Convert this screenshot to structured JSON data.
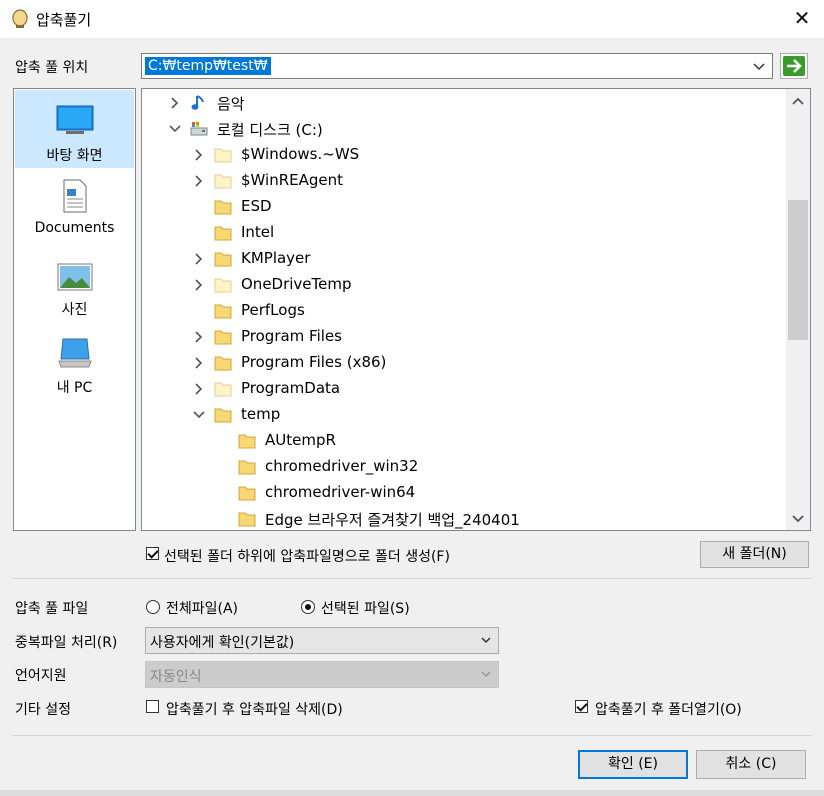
{
  "window": {
    "title": "압축풀기",
    "close_glyph": "✕"
  },
  "path": {
    "label": "압축 풀 위치",
    "value": "C:₩temp₩test₩"
  },
  "places": [
    {
      "label": "바탕 화면",
      "icon": "desktop-icon"
    },
    {
      "label": "Documents",
      "icon": "documents-icon"
    },
    {
      "label": "사진",
      "icon": "pictures-icon"
    },
    {
      "label": "내 PC",
      "icon": "computer-icon"
    }
  ],
  "tree": [
    {
      "label": "음악",
      "icon": "music-icon",
      "expander": "collapsed"
    },
    {
      "label": "로컬 디스크 (C:)",
      "icon": "drive-icon",
      "expander": "expanded"
    },
    {
      "label": "$Windows.~WS",
      "icon": "folder-pale-icon",
      "expander": "collapsed"
    },
    {
      "label": "$WinREAgent",
      "icon": "folder-pale-icon",
      "expander": "collapsed"
    },
    {
      "label": "ESD",
      "icon": "folder-icon",
      "expander": "none"
    },
    {
      "label": "Intel",
      "icon": "folder-icon",
      "expander": "none"
    },
    {
      "label": "KMPlayer",
      "icon": "folder-icon",
      "expander": "collapsed"
    },
    {
      "label": "OneDriveTemp",
      "icon": "folder-pale-icon",
      "expander": "collapsed"
    },
    {
      "label": "PerfLogs",
      "icon": "folder-icon",
      "expander": "none"
    },
    {
      "label": "Program Files",
      "icon": "folder-icon",
      "expander": "collapsed"
    },
    {
      "label": "Program Files (x86)",
      "icon": "folder-icon",
      "expander": "collapsed"
    },
    {
      "label": "ProgramData",
      "icon": "folder-pale-icon",
      "expander": "collapsed"
    },
    {
      "label": "temp",
      "icon": "folder-icon",
      "expander": "expanded"
    },
    {
      "label": "AUtempR",
      "icon": "folder-icon",
      "expander": "none"
    },
    {
      "label": "chromedriver_win32",
      "icon": "folder-icon",
      "expander": "none"
    },
    {
      "label": "chromedriver-win64",
      "icon": "folder-icon",
      "expander": "none"
    },
    {
      "label": "Edge 브라우저 즐겨찾기 백업_240401",
      "icon": "folder-icon",
      "expander": "none"
    }
  ],
  "options": {
    "create_subfolder": {
      "label": "선택된 폴더 하위에 압축파일명으로 폴더 생성(F)",
      "checked": true
    },
    "new_folder_button": "새 폴더(N)",
    "extract_files": {
      "label": "압축 풀 파일",
      "all_label": "전체파일(A)",
      "selected_label": "선택된 파일(S)",
      "selected": "selected"
    },
    "duplicate": {
      "label": "중복파일 처리(R)",
      "value": "사용자에게 확인(기본값)"
    },
    "language": {
      "label": "언어지원",
      "value": "자동인식",
      "disabled": true
    },
    "other": {
      "label": "기타 설정",
      "delete_after": {
        "label": "압축풀기 후 압축파일 삭제(D)",
        "checked": false
      },
      "open_after": {
        "label": "압축풀기 후 폴더열기(O)",
        "checked": true
      }
    }
  },
  "buttons": {
    "ok": "확인 (E)",
    "cancel": "취소 (C)"
  },
  "colors": {
    "selection": "#0078d7",
    "place_selected": "#cce8ff",
    "folder": "#f8d775",
    "go_arrow": "#3a9a2a"
  }
}
